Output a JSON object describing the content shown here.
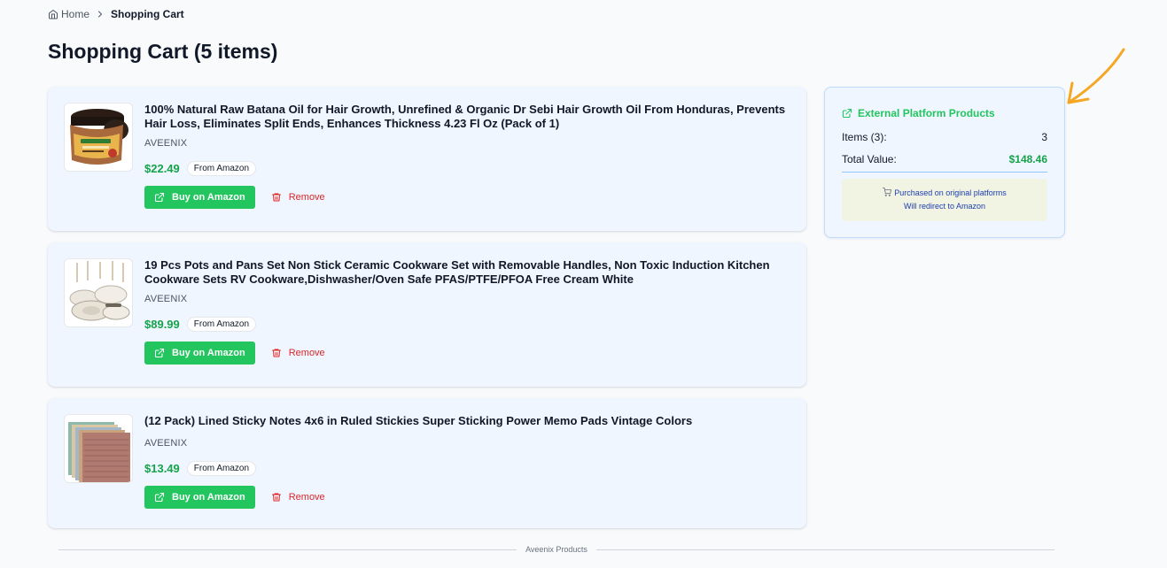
{
  "breadcrumb": {
    "home": "Home",
    "current": "Shopping Cart"
  },
  "page_title": "Shopping Cart (5 items)",
  "items": [
    {
      "title": "100% Natural Raw Batana Oil for Hair Growth, Unrefined & Organic Dr Sebi Hair Growth Oil From Honduras, Prevents Hair Loss, Eliminates Split Ends, Enhances Thickness 4.23 Fl Oz (Pack of 1)",
      "brand": "AVEENIX",
      "price": "$22.49",
      "source": "From Amazon",
      "buy_label": "Buy on Amazon",
      "remove_label": "Remove",
      "image": "batana-oil-jar"
    },
    {
      "title": "19 Pcs Pots and Pans Set Non Stick Ceramic Cookware Set with Removable Handles, Non Toxic Induction Kitchen Cookware Sets RV Cookware,Dishwasher/Oven Safe PFAS/PTFE/PFOA Free Cream White",
      "brand": "AVEENIX",
      "price": "$89.99",
      "source": "From Amazon",
      "buy_label": "Buy on Amazon",
      "remove_label": "Remove",
      "image": "cookware-set"
    },
    {
      "title": "(12 Pack) Lined Sticky Notes 4x6 in Ruled Stickies Super Sticking Power Memo Pads Vintage Colors",
      "brand": "AVEENIX",
      "price": "$13.49",
      "source": "From Amazon",
      "buy_label": "Buy on Amazon",
      "remove_label": "Remove",
      "image": "sticky-notes"
    }
  ],
  "summary": {
    "heading": "External Platform Products",
    "items_label": "Items (3):",
    "items_value": "3",
    "total_label": "Total Value:",
    "total_value": "$148.46",
    "note_line1": "Purchased on original platforms",
    "note_line2": "Will redirect to Amazon"
  },
  "footer": {
    "label": "Aveenix Products"
  },
  "icons": {
    "home": "home-icon",
    "chevron": "chevron-right-icon",
    "external": "external-link-icon",
    "trash": "trash-icon",
    "cart": "cart-icon",
    "arrow": "annotation-arrow-icon"
  },
  "colors": {
    "accent_green": "#22c55e",
    "price_green": "#16a34a",
    "remove_red": "#dc2626",
    "card_bg": "#eff6ff",
    "arrow_orange": "#f5a623"
  }
}
